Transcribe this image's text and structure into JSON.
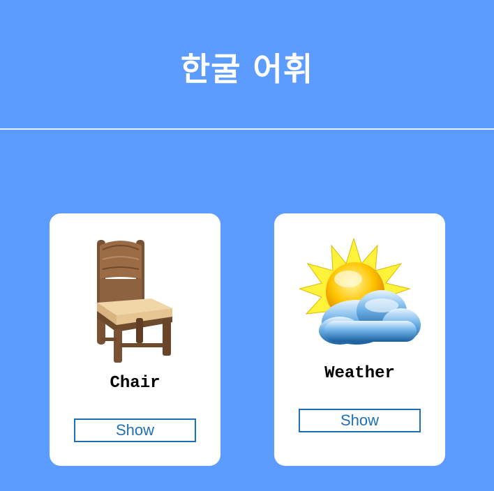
{
  "header": {
    "title": "한굴 어휘"
  },
  "cards": [
    {
      "label": "Chair",
      "button_label": "Show",
      "image": "chair-image"
    },
    {
      "label": "Weather",
      "button_label": "Show",
      "image": "weather-image"
    }
  ]
}
